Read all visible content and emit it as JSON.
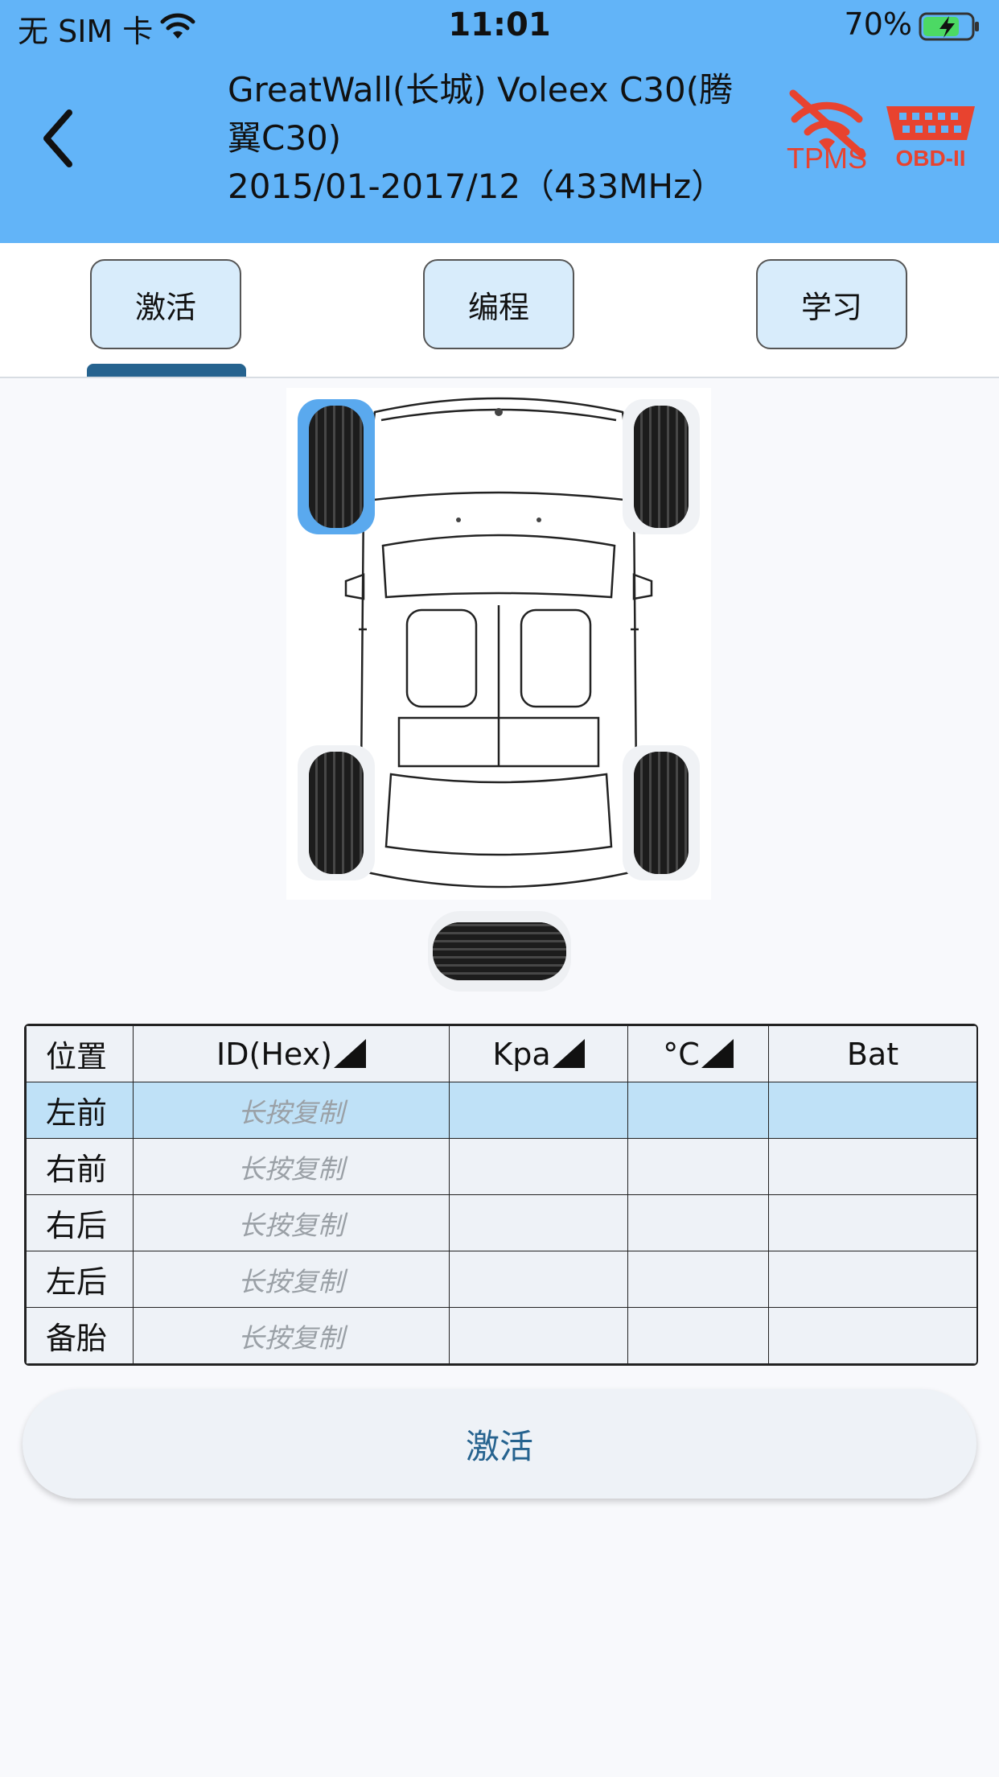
{
  "status_bar": {
    "carrier": "无 SIM 卡",
    "time": "11:01",
    "battery": "70%"
  },
  "header": {
    "title_line1": "GreatWall(长城) Voleex C30(腾",
    "title_line2": "翼C30)",
    "title_line3": "2015/01-2017/12（433MHz）",
    "tpms_label": "TPMS",
    "obd_label": "OBD-II",
    "background": "#62b4f8",
    "alert_color": "#e8432f"
  },
  "tabs": [
    {
      "label": "激活",
      "active": true
    },
    {
      "label": "编程",
      "active": false
    },
    {
      "label": "学习",
      "active": false
    }
  ],
  "wheels": {
    "selected": "front-left"
  },
  "table": {
    "headers": [
      "位置",
      "ID(Hex)",
      "Kpa",
      "°C",
      "Bat"
    ],
    "rows": [
      {
        "position": "左前",
        "id": "长按复制",
        "kpa": "",
        "temp": "",
        "bat": ""
      },
      {
        "position": "右前",
        "id": "长按复制",
        "kpa": "",
        "temp": "",
        "bat": ""
      },
      {
        "position": "右后",
        "id": "长按复制",
        "kpa": "",
        "temp": "",
        "bat": ""
      },
      {
        "position": "左后",
        "id": "长按复制",
        "kpa": "",
        "temp": "",
        "bat": ""
      },
      {
        "position": "备胎",
        "id": "长按复制",
        "kpa": "",
        "temp": "",
        "bat": ""
      }
    ],
    "selected_row": 0
  },
  "action_button": {
    "label": "激活"
  }
}
